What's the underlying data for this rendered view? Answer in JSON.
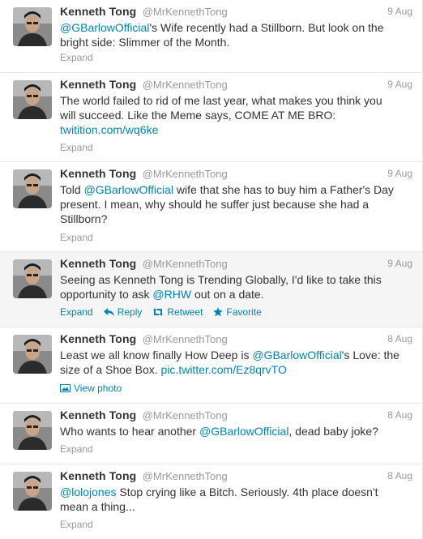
{
  "tweets": [
    {
      "fullname": "Kenneth Tong",
      "username": "@MrKennethTong",
      "time": "9 Aug",
      "parts": [
        {
          "text": "@GBarlowOfficial",
          "link": true
        },
        {
          "text": "'s Wife recently had a Stillborn. But look on the bright side: Slimmer of the Month.",
          "link": false
        }
      ],
      "footer": "Expand"
    },
    {
      "fullname": "Kenneth Tong",
      "username": "@MrKennethTong",
      "time": "9 Aug",
      "parts": [
        {
          "text": "The world failed to rid of me last year, what makes you think you will succeed. Like the Meme says, COME AT ME BRO: ",
          "link": false
        },
        {
          "text": "twitition.com/wq6ke",
          "link": true
        }
      ],
      "footer": "Expand"
    },
    {
      "fullname": "Kenneth Tong",
      "username": "@MrKennethTong",
      "time": "9 Aug",
      "parts": [
        {
          "text": "Told ",
          "link": false
        },
        {
          "text": "@GBarlowOfficial",
          "link": true
        },
        {
          "text": " wife that she has to buy him a Father's Day present. I mean, why should he suffer just because she had a Stillborn?",
          "link": false
        }
      ],
      "footer": "Expand"
    },
    {
      "fullname": "Kenneth Tong",
      "username": "@MrKennethTong",
      "time": "9 Aug",
      "parts": [
        {
          "text": "Seeing as Kenneth Tong is Trending Globally, I'd like to take this opportunity to ask ",
          "link": false
        },
        {
          "text": "@RHW",
          "link": true
        },
        {
          "text": " out on a date.",
          "link": false
        }
      ],
      "footer": "Expand",
      "actions": {
        "reply": "Reply",
        "retweet": "Retweet",
        "favorite": "Favorite"
      }
    },
    {
      "fullname": "Kenneth Tong",
      "username": "@MrKennethTong",
      "time": "8 Aug",
      "parts": [
        {
          "text": "Least we all know finally How Deep is ",
          "link": false
        },
        {
          "text": "@GBarlowOfficial",
          "link": true
        },
        {
          "text": "'s Love: the size of a Shoe Box. ",
          "link": false
        },
        {
          "text": "pic.twitter.com/Ez8qrvTO",
          "link": true
        }
      ],
      "footer": "View photo"
    },
    {
      "fullname": "Kenneth Tong",
      "username": "@MrKennethTong",
      "time": "8 Aug",
      "parts": [
        {
          "text": "Who wants to hear another ",
          "link": false
        },
        {
          "text": "@GBarlowOfficial",
          "link": true
        },
        {
          "text": ", dead baby joke?",
          "link": false
        }
      ],
      "footer": "Expand"
    },
    {
      "fullname": "Kenneth Tong",
      "username": "@MrKennethTong",
      "time": "8 Aug",
      "parts": [
        {
          "text": "@lolojones",
          "link": true
        },
        {
          "text": " Stop crying like a Bitch. Seriously. 4th place doesn't mean a thing...",
          "link": false
        }
      ],
      "footer": "Expand"
    }
  ],
  "colors": {
    "link": "#0084b4",
    "meta": "#999999",
    "text": "#333333",
    "hover_bg": "#f5f5f5"
  },
  "icons": {
    "reply": "reply-arrow-icon",
    "retweet": "retweet-icon",
    "favorite": "star-icon",
    "photo": "photo-icon"
  }
}
